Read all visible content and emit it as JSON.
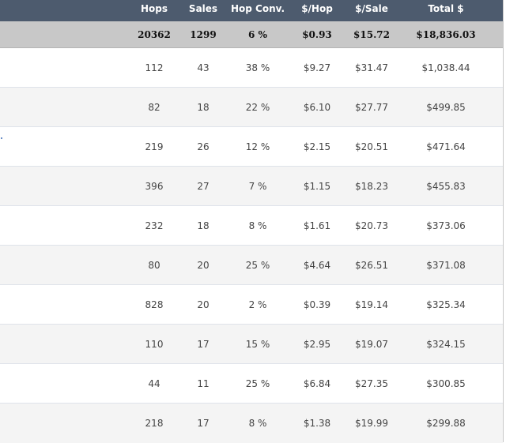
{
  "table": {
    "columns": [
      "Hops",
      "Sales",
      "Hop Conv.",
      "$/Hop",
      "$/Sale",
      "Total $"
    ],
    "totals": {
      "hops": "20362",
      "sales": "1299",
      "conv": "6 %",
      "per_hop": "$0.93",
      "per_sale": "$15.72",
      "total": "$18,836.03"
    },
    "rows": [
      {
        "hops": "112",
        "sales": "43",
        "conv": "38 %",
        "per_hop": "$9.27",
        "per_sale": "$31.47",
        "total": "$1,038.44"
      },
      {
        "hops": "82",
        "sales": "18",
        "conv": "22 %",
        "per_hop": "$6.10",
        "per_sale": "$27.77",
        "total": "$499.85"
      },
      {
        "hops": "219",
        "sales": "26",
        "conv": "12 %",
        "per_hop": "$2.15",
        "per_sale": "$20.51",
        "total": "$471.64"
      },
      {
        "hops": "396",
        "sales": "27",
        "conv": "7 %",
        "per_hop": "$1.15",
        "per_sale": "$18.23",
        "total": "$455.83"
      },
      {
        "hops": "232",
        "sales": "18",
        "conv": "8 %",
        "per_hop": "$1.61",
        "per_sale": "$20.73",
        "total": "$373.06"
      },
      {
        "hops": "80",
        "sales": "20",
        "conv": "25 %",
        "per_hop": "$4.64",
        "per_sale": "$26.51",
        "total": "$371.08"
      },
      {
        "hops": "828",
        "sales": "20",
        "conv": "2 %",
        "per_hop": "$0.39",
        "per_sale": "$19.14",
        "total": "$325.34"
      },
      {
        "hops": "110",
        "sales": "17",
        "conv": "15 %",
        "per_hop": "$2.95",
        "per_sale": "$19.07",
        "total": "$324.15"
      },
      {
        "hops": "44",
        "sales": "11",
        "conv": "25 %",
        "per_hop": "$6.84",
        "per_sale": "$27.35",
        "total": "$300.85"
      },
      {
        "hops": "218",
        "sales": "17",
        "conv": "8 %",
        "per_hop": "$1.38",
        "per_sale": "$19.99",
        "total": "$299.88"
      }
    ]
  },
  "colors": {
    "header_bg": "#4d5b6e",
    "totals_bg": "#c8c8c8",
    "row_alt_bg": "#f4f4f4",
    "row_bg": "#ffffff"
  }
}
